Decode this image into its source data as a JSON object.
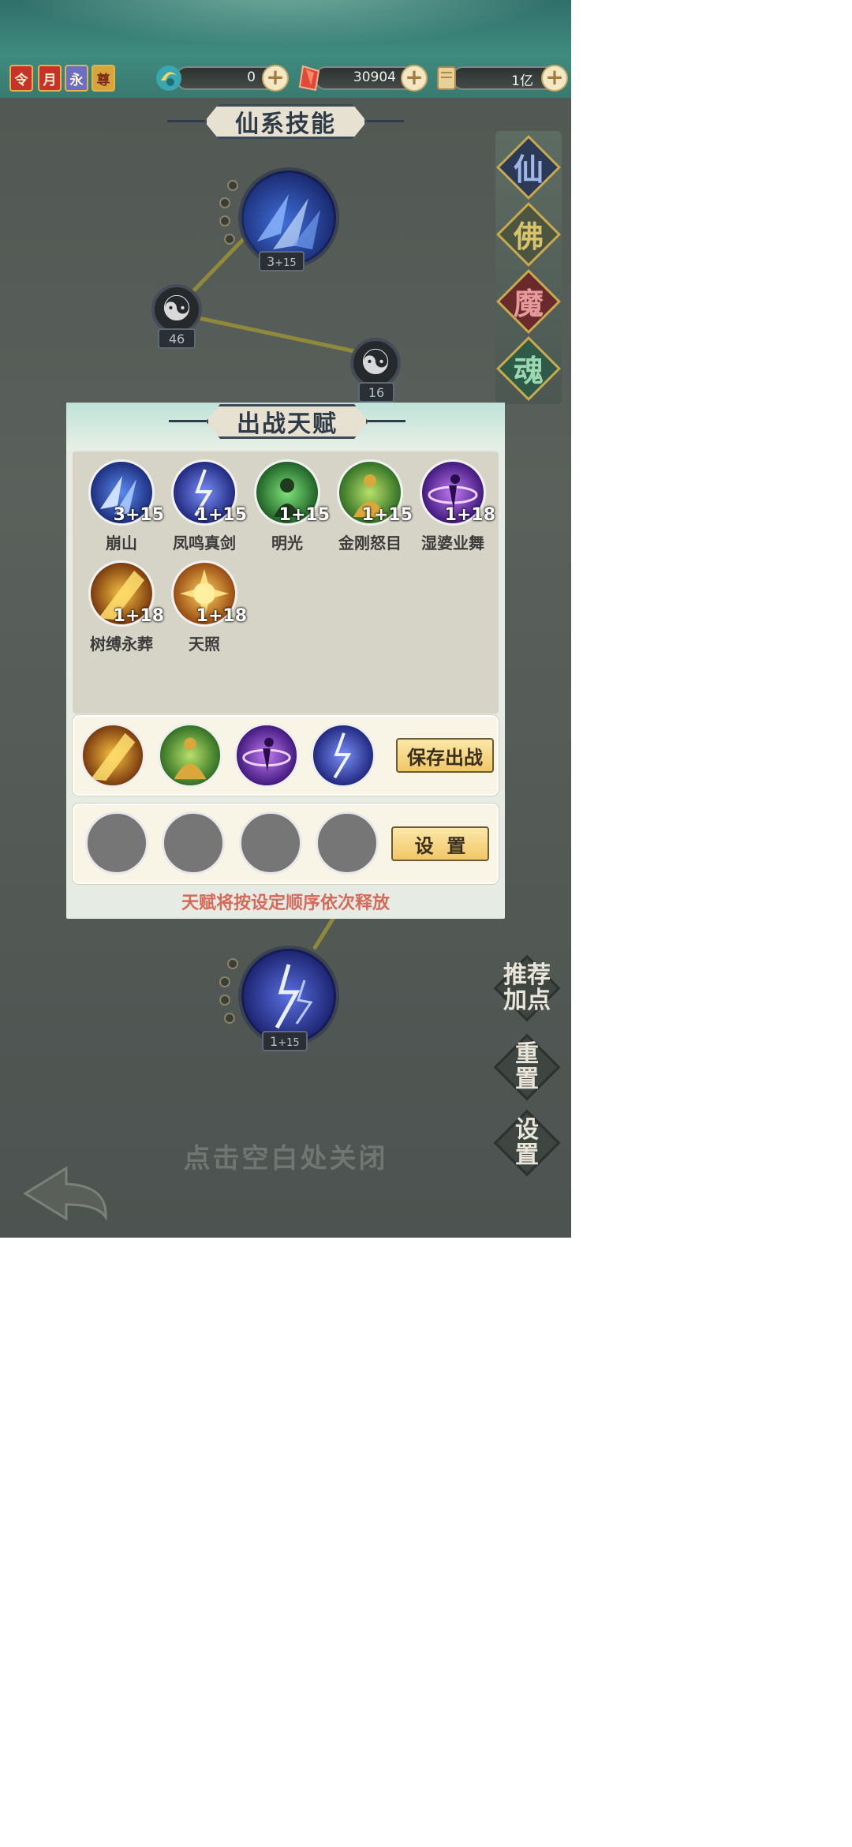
{
  "header": {
    "badges": [
      "令",
      "月",
      "永",
      "尊"
    ],
    "currencies": [
      {
        "name": "jade-currency",
        "value": "0"
      },
      {
        "name": "ruby-currency",
        "value": "30904"
      },
      {
        "name": "scroll-currency",
        "value": "1亿"
      }
    ]
  },
  "tree": {
    "title": "仙系技能",
    "nodes": [
      {
        "level_base": "3",
        "level_bonus": "+15"
      },
      {
        "level": "46"
      },
      {
        "level": "16"
      },
      {
        "level_base": "1",
        "level_bonus": "+15"
      }
    ]
  },
  "side_tabs": [
    "仙",
    "佛",
    "魔",
    "魂"
  ],
  "side_buttons": [
    "推荐\n加点",
    "重\n置",
    "设\n置"
  ],
  "close_hint": "点击空白处关闭",
  "modal": {
    "title": "出战天赋",
    "skills": [
      {
        "name": "崩山",
        "level": "3+15",
        "icon": "ice-shard-icon"
      },
      {
        "name": "凤鸣真剑",
        "level": "1+15",
        "icon": "lightning-icon"
      },
      {
        "name": "明光",
        "level": "1+15",
        "icon": "green-monk-icon"
      },
      {
        "name": "金刚怒目",
        "level": "1+15",
        "icon": "golden-guardian-icon"
      },
      {
        "name": "湿婆业舞",
        "level": "1+18",
        "icon": "purple-dancer-icon"
      },
      {
        "name": "树缚永葬",
        "level": "1+18",
        "icon": "flame-trunk-icon"
      },
      {
        "name": "天照",
        "level": "1+18",
        "icon": "sun-fire-icon"
      }
    ],
    "equipped_row": {
      "slots": [
        "flame-trunk-icon",
        "golden-guardian-icon",
        "purple-dancer-icon",
        "lightning-icon"
      ],
      "button": "保存出战"
    },
    "setup_row": {
      "slots": [
        "empty",
        "empty",
        "empty",
        "empty"
      ],
      "button": "设  置"
    },
    "hint": "天赋将按设定顺序依次释放"
  }
}
